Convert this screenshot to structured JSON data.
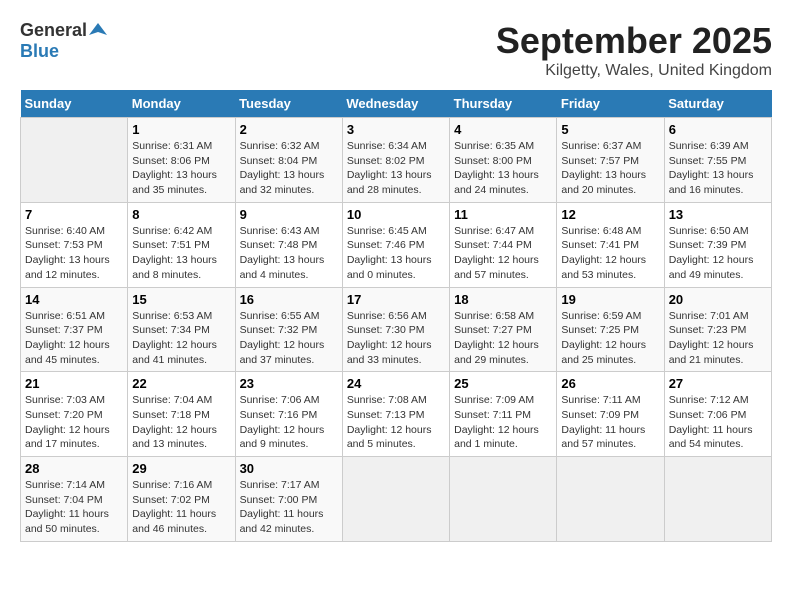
{
  "header": {
    "logo_general": "General",
    "logo_blue": "Blue",
    "month_title": "September 2025",
    "location": "Kilgetty, Wales, United Kingdom"
  },
  "weekdays": [
    "Sunday",
    "Monday",
    "Tuesday",
    "Wednesday",
    "Thursday",
    "Friday",
    "Saturday"
  ],
  "weeks": [
    [
      {
        "day": "",
        "info": ""
      },
      {
        "day": "1",
        "info": "Sunrise: 6:31 AM\nSunset: 8:06 PM\nDaylight: 13 hours\nand 35 minutes."
      },
      {
        "day": "2",
        "info": "Sunrise: 6:32 AM\nSunset: 8:04 PM\nDaylight: 13 hours\nand 32 minutes."
      },
      {
        "day": "3",
        "info": "Sunrise: 6:34 AM\nSunset: 8:02 PM\nDaylight: 13 hours\nand 28 minutes."
      },
      {
        "day": "4",
        "info": "Sunrise: 6:35 AM\nSunset: 8:00 PM\nDaylight: 13 hours\nand 24 minutes."
      },
      {
        "day": "5",
        "info": "Sunrise: 6:37 AM\nSunset: 7:57 PM\nDaylight: 13 hours\nand 20 minutes."
      },
      {
        "day": "6",
        "info": "Sunrise: 6:39 AM\nSunset: 7:55 PM\nDaylight: 13 hours\nand 16 minutes."
      }
    ],
    [
      {
        "day": "7",
        "info": "Sunrise: 6:40 AM\nSunset: 7:53 PM\nDaylight: 13 hours\nand 12 minutes."
      },
      {
        "day": "8",
        "info": "Sunrise: 6:42 AM\nSunset: 7:51 PM\nDaylight: 13 hours\nand 8 minutes."
      },
      {
        "day": "9",
        "info": "Sunrise: 6:43 AM\nSunset: 7:48 PM\nDaylight: 13 hours\nand 4 minutes."
      },
      {
        "day": "10",
        "info": "Sunrise: 6:45 AM\nSunset: 7:46 PM\nDaylight: 13 hours\nand 0 minutes."
      },
      {
        "day": "11",
        "info": "Sunrise: 6:47 AM\nSunset: 7:44 PM\nDaylight: 12 hours\nand 57 minutes."
      },
      {
        "day": "12",
        "info": "Sunrise: 6:48 AM\nSunset: 7:41 PM\nDaylight: 12 hours\nand 53 minutes."
      },
      {
        "day": "13",
        "info": "Sunrise: 6:50 AM\nSunset: 7:39 PM\nDaylight: 12 hours\nand 49 minutes."
      }
    ],
    [
      {
        "day": "14",
        "info": "Sunrise: 6:51 AM\nSunset: 7:37 PM\nDaylight: 12 hours\nand 45 minutes."
      },
      {
        "day": "15",
        "info": "Sunrise: 6:53 AM\nSunset: 7:34 PM\nDaylight: 12 hours\nand 41 minutes."
      },
      {
        "day": "16",
        "info": "Sunrise: 6:55 AM\nSunset: 7:32 PM\nDaylight: 12 hours\nand 37 minutes."
      },
      {
        "day": "17",
        "info": "Sunrise: 6:56 AM\nSunset: 7:30 PM\nDaylight: 12 hours\nand 33 minutes."
      },
      {
        "day": "18",
        "info": "Sunrise: 6:58 AM\nSunset: 7:27 PM\nDaylight: 12 hours\nand 29 minutes."
      },
      {
        "day": "19",
        "info": "Sunrise: 6:59 AM\nSunset: 7:25 PM\nDaylight: 12 hours\nand 25 minutes."
      },
      {
        "day": "20",
        "info": "Sunrise: 7:01 AM\nSunset: 7:23 PM\nDaylight: 12 hours\nand 21 minutes."
      }
    ],
    [
      {
        "day": "21",
        "info": "Sunrise: 7:03 AM\nSunset: 7:20 PM\nDaylight: 12 hours\nand 17 minutes."
      },
      {
        "day": "22",
        "info": "Sunrise: 7:04 AM\nSunset: 7:18 PM\nDaylight: 12 hours\nand 13 minutes."
      },
      {
        "day": "23",
        "info": "Sunrise: 7:06 AM\nSunset: 7:16 PM\nDaylight: 12 hours\nand 9 minutes."
      },
      {
        "day": "24",
        "info": "Sunrise: 7:08 AM\nSunset: 7:13 PM\nDaylight: 12 hours\nand 5 minutes."
      },
      {
        "day": "25",
        "info": "Sunrise: 7:09 AM\nSunset: 7:11 PM\nDaylight: 12 hours\nand 1 minute."
      },
      {
        "day": "26",
        "info": "Sunrise: 7:11 AM\nSunset: 7:09 PM\nDaylight: 11 hours\nand 57 minutes."
      },
      {
        "day": "27",
        "info": "Sunrise: 7:12 AM\nSunset: 7:06 PM\nDaylight: 11 hours\nand 54 minutes."
      }
    ],
    [
      {
        "day": "28",
        "info": "Sunrise: 7:14 AM\nSunset: 7:04 PM\nDaylight: 11 hours\nand 50 minutes."
      },
      {
        "day": "29",
        "info": "Sunrise: 7:16 AM\nSunset: 7:02 PM\nDaylight: 11 hours\nand 46 minutes."
      },
      {
        "day": "30",
        "info": "Sunrise: 7:17 AM\nSunset: 7:00 PM\nDaylight: 11 hours\nand 42 minutes."
      },
      {
        "day": "",
        "info": ""
      },
      {
        "day": "",
        "info": ""
      },
      {
        "day": "",
        "info": ""
      },
      {
        "day": "",
        "info": ""
      }
    ]
  ]
}
